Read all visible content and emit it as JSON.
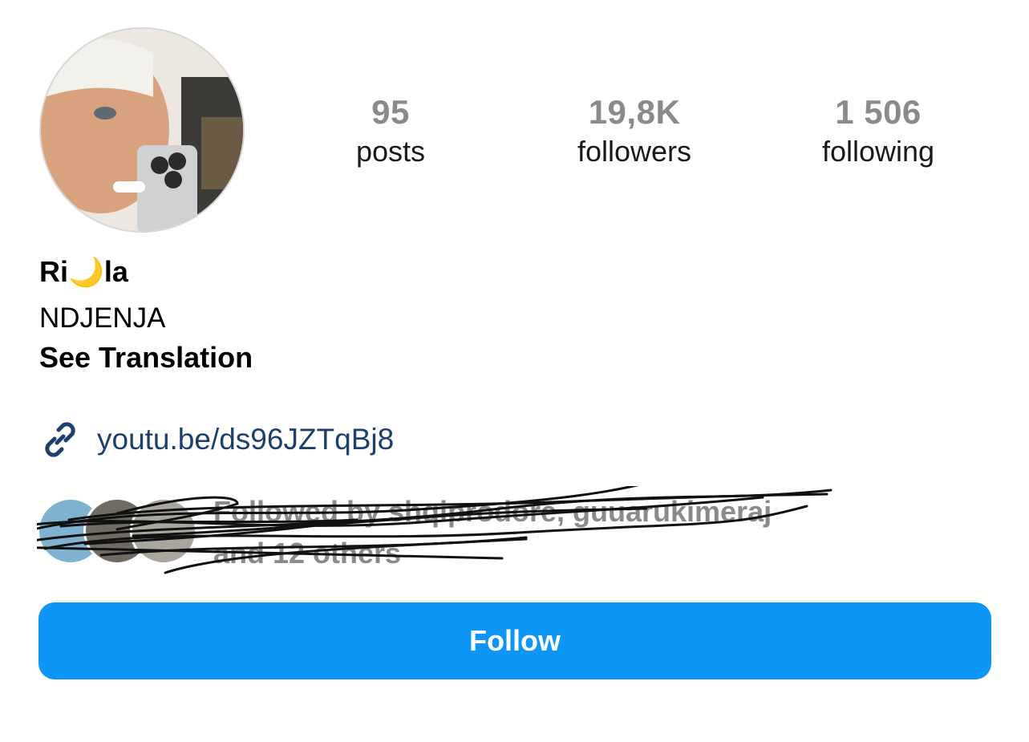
{
  "profile": {
    "avatar_alt": "profile photo",
    "name": "Ri🌙la",
    "bio": "NDJENJA",
    "see_translation": "See Translation",
    "link": "youtu.be/ds96JZTqBj8",
    "link_icon": "link-icon"
  },
  "stats": [
    {
      "value": "95",
      "label": "posts"
    },
    {
      "value": "19,8K",
      "label": "followers"
    },
    {
      "value": "1 506",
      "label": "following"
    }
  ],
  "followed_by": {
    "line1": "Followed by shqiprodore, guuarukimeraj",
    "line2": "and 12 others"
  },
  "actions": {
    "follow_label": "Follow"
  },
  "colors": {
    "follow_button": "#0e96f7",
    "link_text": "#1e3f6b",
    "stat_value": "#8a8a8a"
  }
}
